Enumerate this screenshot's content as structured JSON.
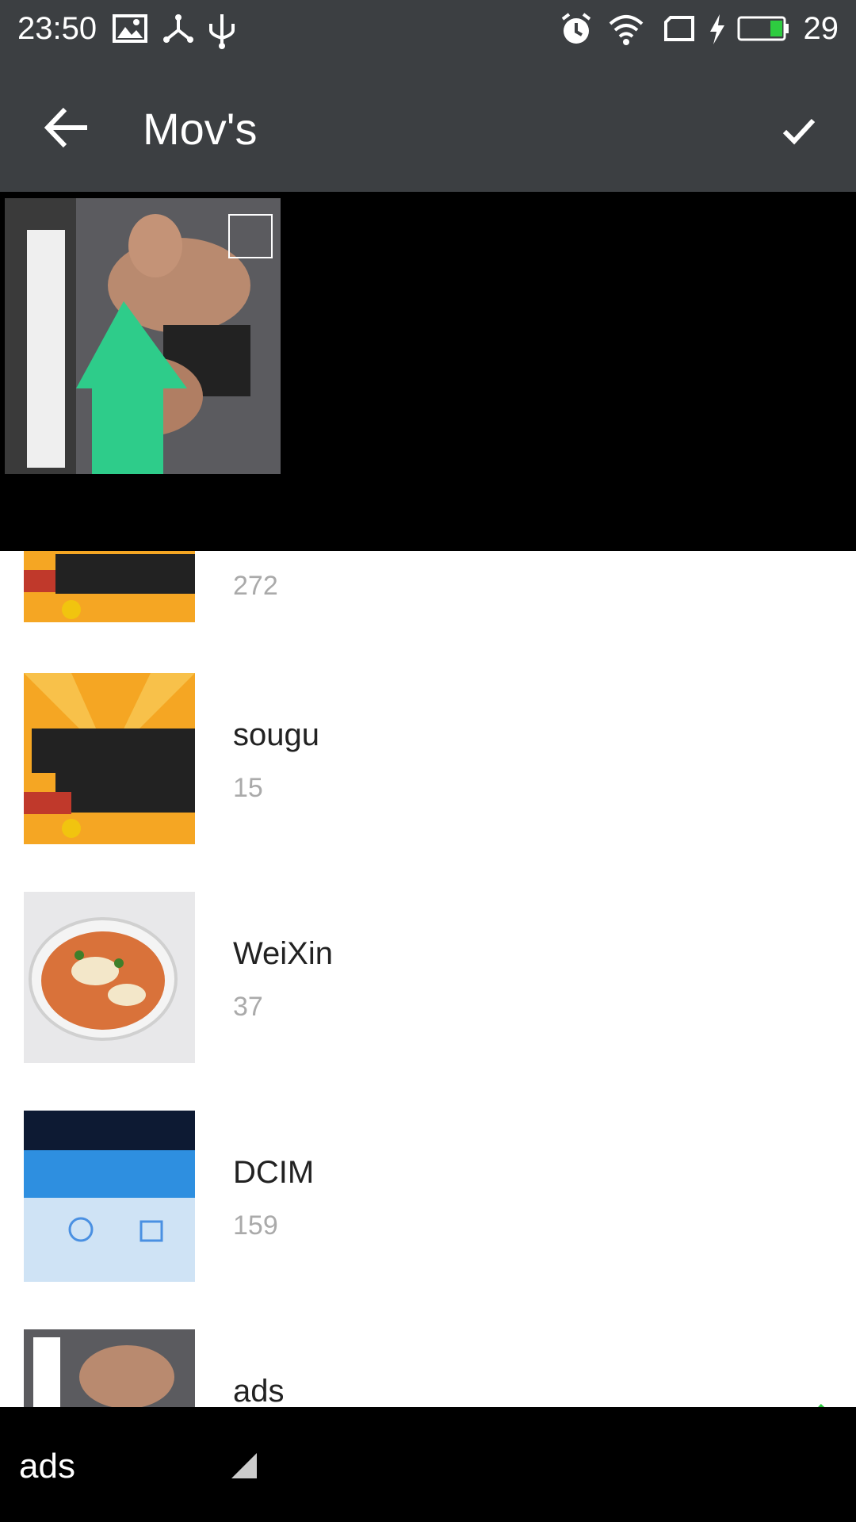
{
  "status_bar": {
    "time": "23:50",
    "battery_level": "29",
    "icons": [
      "image-icon",
      "share-icon",
      "usb-icon",
      "alarm-icon",
      "wifi-icon",
      "sim-icon",
      "charging-icon",
      "battery-icon"
    ]
  },
  "toolbar": {
    "title": "Mov's",
    "back_icon": "arrow-left-icon",
    "done_icon": "check-icon"
  },
  "preview": {
    "selected": false
  },
  "albums": [
    {
      "name": "",
      "count": "272"
    },
    {
      "name": "sougu",
      "count": "15"
    },
    {
      "name": "WeiXin",
      "count": "37"
    },
    {
      "name": "DCIM",
      "count": "159"
    },
    {
      "name": "ads",
      "count": "",
      "checked": true
    }
  ],
  "bottom_bar": {
    "current_album": "ads",
    "dropdown_icon": "corner-triangle-icon"
  },
  "colors": {
    "toolbar": "#3c3f42",
    "accent": "#2ecc40",
    "count_text": "#aaaaaa"
  }
}
